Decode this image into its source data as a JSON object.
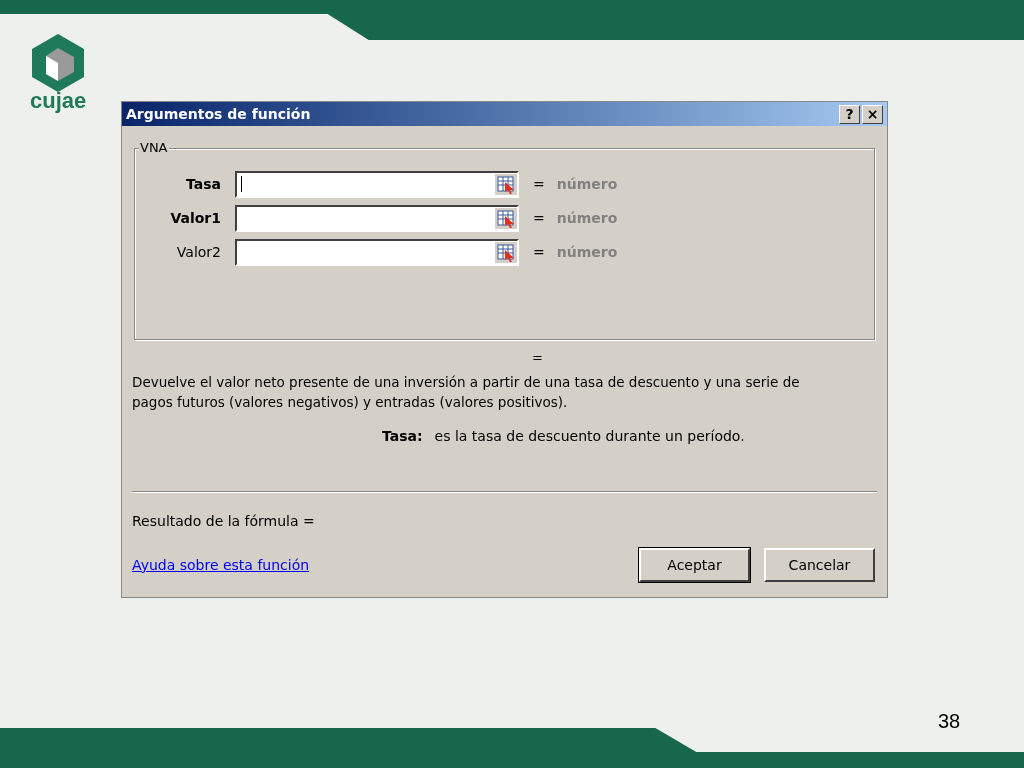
{
  "slide": {
    "logo_text": "cujae",
    "page_number": "38"
  },
  "window": {
    "title": "Argumentos de función",
    "title_buttons": [
      "?",
      "×"
    ]
  },
  "group": {
    "label": "VNA"
  },
  "arguments": [
    {
      "label": "Tasa",
      "required": true,
      "focused": true,
      "equals": "=",
      "result": "número"
    },
    {
      "label": "Valor1",
      "required": true,
      "focused": false,
      "equals": "=",
      "result": "número"
    },
    {
      "label": "Valor2",
      "required": false,
      "focused": false,
      "equals": "=",
      "result": "número"
    }
  ],
  "function_result": "=",
  "description": "Devuelve el valor neto presente de una inversión a partir de una tasa de descuento y una serie de pagos futuros (valores negativos) y entradas (valores positivos).",
  "argument_help": {
    "label": "Tasa:",
    "text": "es la tasa de descuento durante un período."
  },
  "formula_result": "Resultado de la fórmula =",
  "help_link": "Ayuda sobre esta función",
  "buttons": [
    {
      "label": "Aceptar",
      "default": true
    },
    {
      "label": "Cancelar",
      "default": false
    }
  ]
}
